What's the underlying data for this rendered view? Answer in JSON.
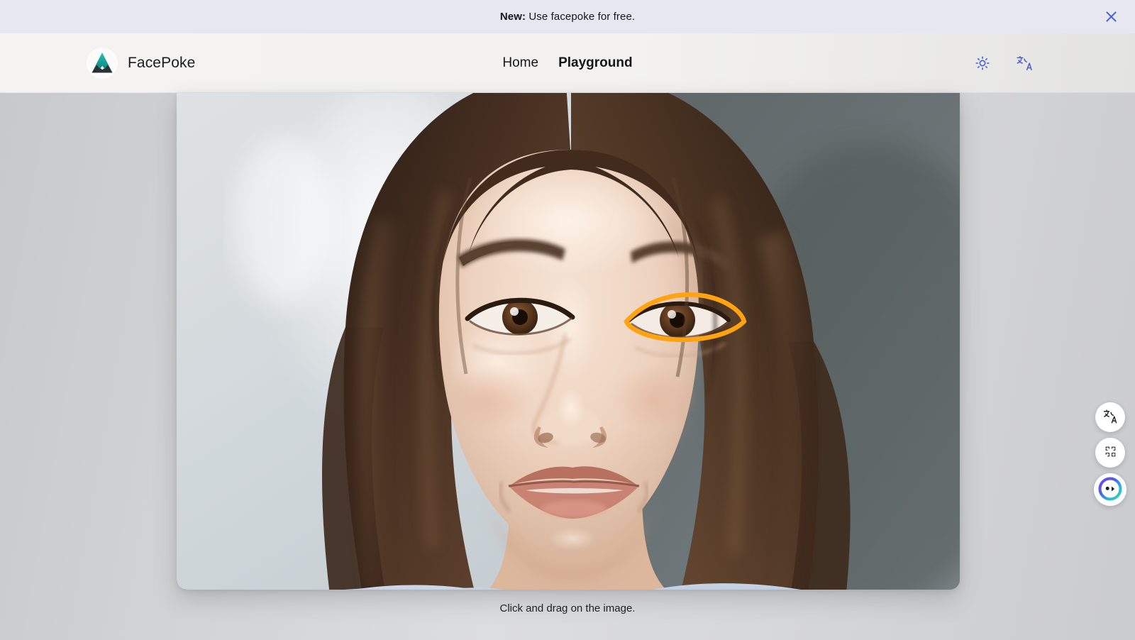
{
  "announcement": {
    "prefix": "New:",
    "message": "Use facepoke for free.",
    "close_icon": "close-icon"
  },
  "header": {
    "brand": {
      "name": "FacePoke",
      "logo_icon": "mountain-peak-logo-icon",
      "logo_colors": {
        "peak": "#19a5a0",
        "peak_dark": "#0f7e7e",
        "rock": "#2b3136"
      }
    },
    "nav": [
      {
        "label": "Home",
        "active": false
      },
      {
        "label": "Playground",
        "active": true
      }
    ],
    "actions": [
      {
        "icon": "sun-theme-icon",
        "label": "Toggle theme"
      },
      {
        "icon": "translate-icon",
        "label": "Translate page"
      }
    ],
    "icon_color": "#4a5bd0"
  },
  "stage": {
    "hint": "Click and drag on the image.",
    "photo": {
      "alt": "Portrait of a smiling woman with long wavy brown hair",
      "overlay": {
        "name": "eye-landmark-outline",
        "color": "#FFA311",
        "stroke_width": 4
      }
    }
  },
  "floating_dock": [
    {
      "icon": "translate-icon",
      "name": "translate-fab"
    },
    {
      "icon": "apps-grid-icon",
      "name": "apps-grid-fab"
    },
    {
      "icon": "assistant-avatar-icon",
      "name": "assistant-fab"
    }
  ],
  "colors": {
    "banner_bg": "#e7e7ef",
    "header_bg": "#f4f3f2",
    "page_bg": "#d2d3d5",
    "text": "#15171a",
    "accent_blue": "#4a5bd0",
    "overlay_orange": "#FFA311",
    "brand_teal": "#19a5a0"
  }
}
